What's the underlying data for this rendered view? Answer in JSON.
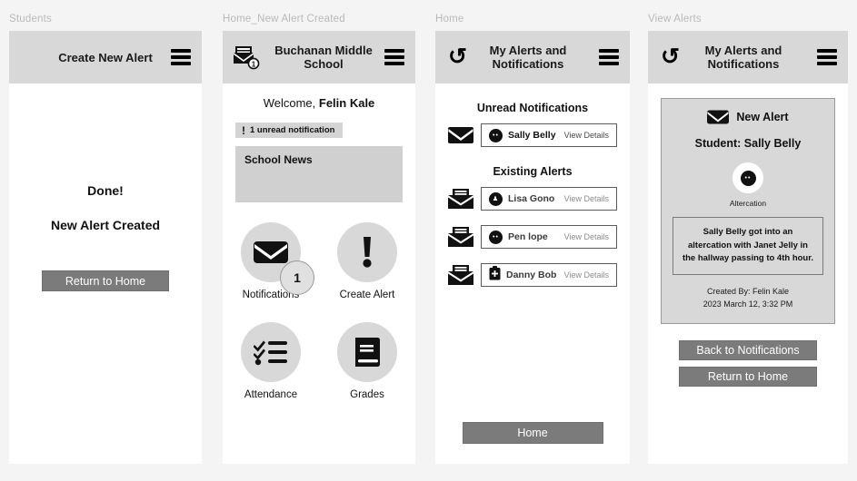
{
  "frames": [
    {
      "label": "Students",
      "topbar": {
        "title": "Create New Alert",
        "menu_icon": "hamburger-icon"
      },
      "done_title": "Done!",
      "done_sub": "New Alert Created",
      "primary_button": "Return to Home"
    },
    {
      "label": "Home_New Alert Created",
      "topbar": {
        "title": "Buchanan Middle School",
        "menu_icon": "hamburger-icon",
        "left_icon": "mail-badge-icon",
        "left_icon_badge": "1"
      },
      "welcome_prefix": "Welcome, ",
      "welcome_name": "Felin Kale",
      "unread_badge": "1 unread notification",
      "news_title": "School News",
      "tiles": [
        {
          "label": "Notifications",
          "icon": "envelope-icon",
          "badge": "1"
        },
        {
          "label": "Create Alert",
          "icon": "exclamation-icon"
        },
        {
          "label": "Attendance",
          "icon": "checklist-icon"
        },
        {
          "label": "Grades",
          "icon": "book-icon"
        }
      ]
    },
    {
      "label": "Home",
      "topbar": {
        "title": "My Alerts and Notifications",
        "menu_icon": "hamburger-icon",
        "back_icon": "undo-arrow-icon"
      },
      "unread_heading": "Unread Notifications",
      "unread": [
        {
          "name": "Sally Belly",
          "link": "View Details",
          "avatar": "angry-face-icon",
          "leading_icon": "closed-envelope-icon"
        }
      ],
      "existing_heading": "Existing Alerts",
      "existing": [
        {
          "name": "Lisa Gono",
          "link": "View Details",
          "avatar": "person-icon",
          "leading_icon": "open-envelope-icon"
        },
        {
          "name": "Pen lope",
          "link": "View Details",
          "avatar": "angry-face-icon",
          "leading_icon": "open-envelope-icon"
        },
        {
          "name": "Danny Bob",
          "link": "View Details",
          "avatar": "medical-clipboard-icon",
          "leading_icon": "open-envelope-icon"
        }
      ],
      "home_button": "Home"
    },
    {
      "label": "View Alerts",
      "topbar": {
        "title": "My Alerts and Notifications",
        "menu_icon": "hamburger-icon",
        "back_icon": "undo-arrow-icon"
      },
      "card": {
        "heading": "New Alert",
        "heading_icon": "envelope-icon",
        "student": "Student: Sally Belly",
        "avatar_icon": "angry-face-icon",
        "type": "Altercation",
        "description": "Sally Belly got into an altercation with Janet Jelly in the hallway passing to 4th hour.",
        "created_by": "Created By: Felin Kale",
        "created_at": "2023 March 12, 3:32 PM"
      },
      "buttons": [
        "Back to Notifications",
        "Return to Home"
      ]
    }
  ],
  "colors": {
    "page_bg": "#f4f4f4",
    "topbar_bg": "#d8d8d8",
    "button_bg": "#7b7b7b",
    "label_gray": "#b9b9b9"
  }
}
